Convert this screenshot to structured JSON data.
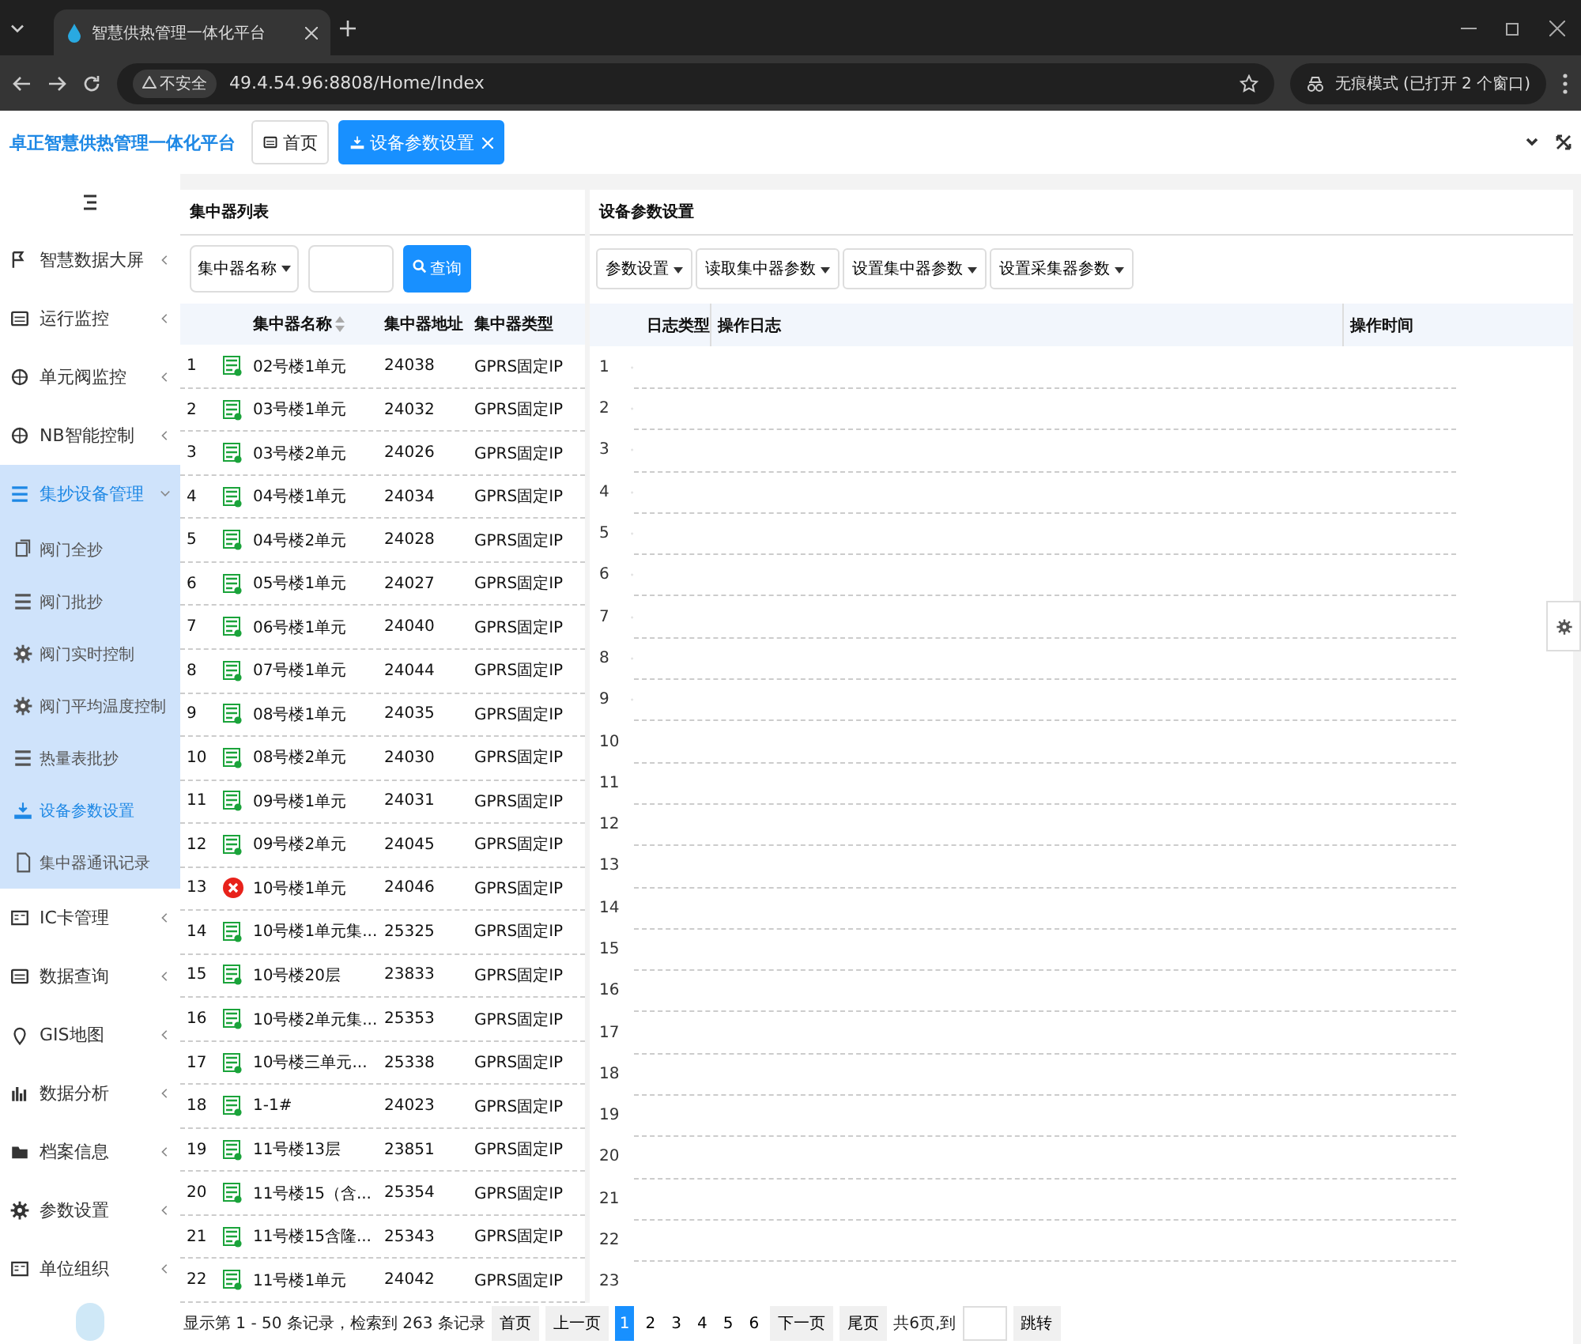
{
  "browser": {
    "tab_title": "智慧供热管理一体化平台",
    "security_label": "不安全",
    "url": "49.4.54.96:8808/Home/Index",
    "incognito_label": "无痕模式 (已打开 2 个窗口)"
  },
  "app_header": {
    "logo": "卓正智慧供热管理一体化平台",
    "tabs": [
      {
        "label": "首页",
        "selected": false,
        "closable": false
      },
      {
        "label": "设备参数设置",
        "selected": true,
        "closable": true
      }
    ]
  },
  "sidebar": {
    "items": [
      {
        "label": "智慧数据大屏",
        "expanded": false,
        "selected": false
      },
      {
        "label": "运行监控",
        "expanded": false,
        "selected": false
      },
      {
        "label": "单元阀监控",
        "expanded": false,
        "selected": false
      },
      {
        "label": "NB智能控制",
        "expanded": false,
        "selected": false
      },
      {
        "label": "集抄设备管理",
        "expanded": true,
        "selected": true,
        "children": [
          {
            "label": "阀门全抄",
            "selected": false
          },
          {
            "label": "阀门批抄",
            "selected": false
          },
          {
            "label": "阀门实时控制",
            "selected": false
          },
          {
            "label": "阀门平均温度控制",
            "selected": false
          },
          {
            "label": "热量表批抄",
            "selected": false
          },
          {
            "label": "设备参数设置",
            "selected": true
          },
          {
            "label": "集中器通讯记录",
            "selected": false
          }
        ]
      },
      {
        "label": "IC卡管理",
        "expanded": false,
        "selected": false
      },
      {
        "label": "数据查询",
        "expanded": false,
        "selected": false
      },
      {
        "label": "GIS地图",
        "expanded": false,
        "selected": false
      },
      {
        "label": "数据分析",
        "expanded": false,
        "selected": false
      },
      {
        "label": "档案信息",
        "expanded": false,
        "selected": false
      },
      {
        "label": "参数设置",
        "expanded": false,
        "selected": false
      },
      {
        "label": "单位组织",
        "expanded": false,
        "selected": false
      }
    ]
  },
  "concentrator_panel": {
    "title": "集中器列表",
    "filter_dropdown": "集中器名称",
    "search_button": "查询",
    "columns": [
      "集中器名称",
      "集中器地址",
      "集中器类型"
    ],
    "rows": [
      {
        "index": "1",
        "kind": "online",
        "name": "02号楼1单元",
        "address": "24038",
        "type": "GPRS固定IP"
      },
      {
        "index": "2",
        "kind": "online",
        "name": "03号楼1单元",
        "address": "24032",
        "type": "GPRS固定IP"
      },
      {
        "index": "3",
        "kind": "online",
        "name": "03号楼2单元",
        "address": "24026",
        "type": "GPRS固定IP"
      },
      {
        "index": "4",
        "kind": "online",
        "name": "04号楼1单元",
        "address": "24034",
        "type": "GPRS固定IP"
      },
      {
        "index": "5",
        "kind": "online",
        "name": "04号楼2单元",
        "address": "24028",
        "type": "GPRS固定IP"
      },
      {
        "index": "6",
        "kind": "online",
        "name": "05号楼1单元",
        "address": "24027",
        "type": "GPRS固定IP"
      },
      {
        "index": "7",
        "kind": "online",
        "name": "06号楼1单元",
        "address": "24040",
        "type": "GPRS固定IP"
      },
      {
        "index": "8",
        "kind": "online",
        "name": "07号楼1单元",
        "address": "24044",
        "type": "GPRS固定IP"
      },
      {
        "index": "9",
        "kind": "online",
        "name": "08号楼1单元",
        "address": "24035",
        "type": "GPRS固定IP"
      },
      {
        "index": "10",
        "kind": "online",
        "name": "08号楼2单元",
        "address": "24030",
        "type": "GPRS固定IP"
      },
      {
        "index": "11",
        "kind": "online",
        "name": "09号楼1单元",
        "address": "24031",
        "type": "GPRS固定IP"
      },
      {
        "index": "12",
        "kind": "online",
        "name": "09号楼2单元",
        "address": "24045",
        "type": "GPRS固定IP"
      },
      {
        "index": "13",
        "kind": "offline",
        "name": "10号楼1单元",
        "address": "24046",
        "type": "GPRS固定IP"
      },
      {
        "index": "14",
        "kind": "online",
        "name": "10号楼1单元集...",
        "address": "25325",
        "type": "GPRS固定IP"
      },
      {
        "index": "15",
        "kind": "online",
        "name": "10号楼20层",
        "address": "23833",
        "type": "GPRS固定IP"
      },
      {
        "index": "16",
        "kind": "online",
        "name": "10号楼2单元集...",
        "address": "25353",
        "type": "GPRS固定IP"
      },
      {
        "index": "17",
        "kind": "online",
        "name": "10号楼三单元...",
        "address": "25338",
        "type": "GPRS固定IP"
      },
      {
        "index": "18",
        "kind": "online",
        "name": "1-1#",
        "address": "24023",
        "type": "GPRS固定IP"
      },
      {
        "index": "19",
        "kind": "online",
        "name": "11号楼13层",
        "address": "23851",
        "type": "GPRS固定IP"
      },
      {
        "index": "20",
        "kind": "online",
        "name": "11号楼15（含...",
        "address": "25354",
        "type": "GPRS固定IP"
      },
      {
        "index": "21",
        "kind": "online",
        "name": "11号楼15含隆...",
        "address": "25343",
        "type": "GPRS固定IP"
      },
      {
        "index": "22",
        "kind": "online",
        "name": "11号楼1单元",
        "address": "24042",
        "type": "GPRS固定IP"
      }
    ],
    "pagination": {
      "summary": "显示第 1 - 50 条记录，检索到 263 条记录",
      "first": "首页",
      "prev": "上一页",
      "pages": [
        {
          "label": "1",
          "selected": true
        },
        {
          "label": "2",
          "selected": false
        },
        {
          "label": "3",
          "selected": false
        },
        {
          "label": "4",
          "selected": false
        },
        {
          "label": "5",
          "selected": false
        },
        {
          "label": "6",
          "selected": false
        }
      ],
      "next": "下一页",
      "last": "尾页",
      "total_label": "共6页,到",
      "go_button": "跳转"
    }
  },
  "settings_panel": {
    "title": "设备参数设置",
    "toolbar": [
      "参数设置",
      "读取集中器参数",
      "设置集中器参数",
      "设置采集器参数"
    ],
    "columns": [
      "日志类型",
      "操作日志",
      "操作时间"
    ],
    "row_numbers": [
      "1",
      "2",
      "3",
      "4",
      "5",
      "6",
      "7",
      "8",
      "9",
      "10",
      "11",
      "12",
      "13",
      "14",
      "15",
      "16",
      "17",
      "18",
      "19",
      "20",
      "21",
      "22",
      "23"
    ]
  }
}
